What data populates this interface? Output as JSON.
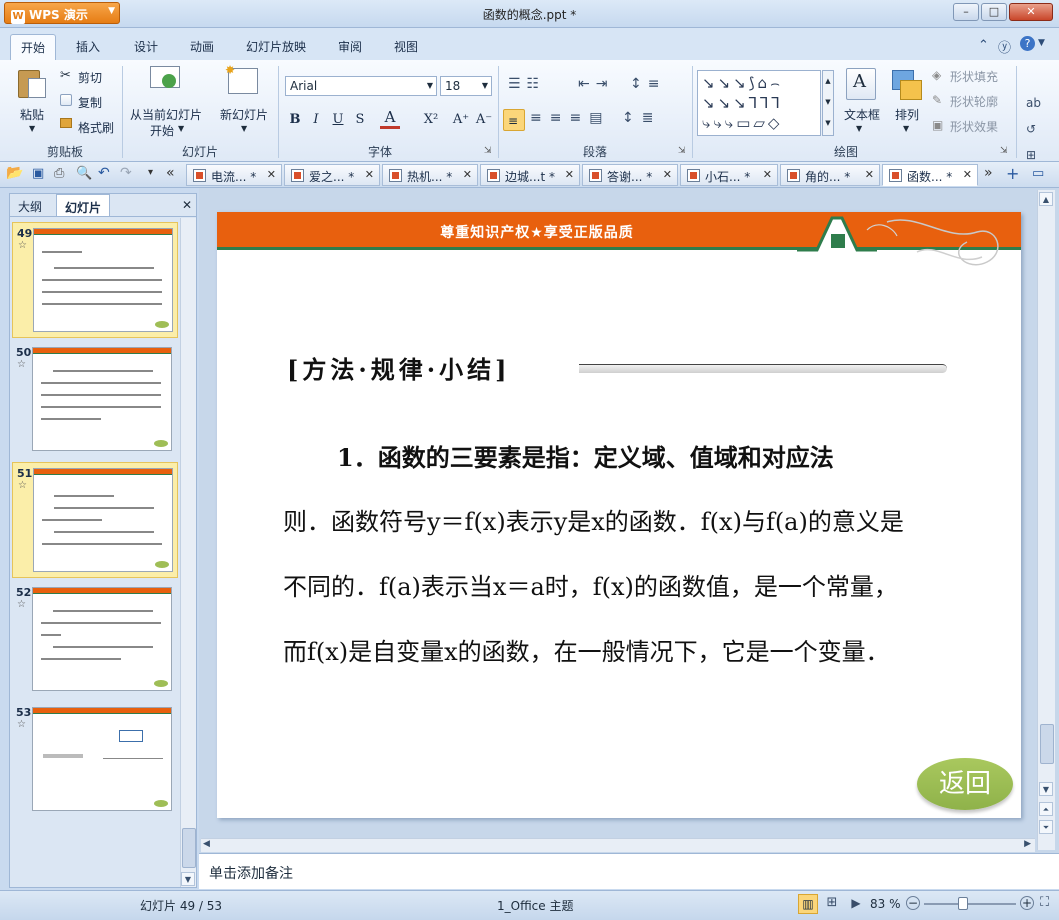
{
  "app": {
    "name": "WPS 演示",
    "title": "函数的概念.ppt *"
  },
  "window_controls": {
    "minimize": "–",
    "restore": "□",
    "close": "✕"
  },
  "ribbon_tabs": [
    "开始",
    "插入",
    "设计",
    "动画",
    "幻灯片放映",
    "审阅",
    "视图"
  ],
  "active_tab": "开始",
  "clipboard": {
    "paste": "粘贴",
    "cut": "剪切",
    "copy": "复制",
    "format_painter": "格式刷",
    "group": "剪贴板"
  },
  "slides_group": {
    "from_current": "从当前幻灯片",
    "start": "开始",
    "new_slide": "新幻灯片",
    "group": "幻灯片"
  },
  "font_group": {
    "font_name": "Arial",
    "font_size": "18",
    "bold": "B",
    "italic": "I",
    "underline": "U",
    "shadow": "S",
    "color_a": "A",
    "superscript": "X²",
    "grow": "A⁺",
    "shrink": "A⁻",
    "group": "字体"
  },
  "paragraph_group": {
    "group": "段落"
  },
  "drawing_group": {
    "text_box": "文本框",
    "arrange": "排列",
    "shape_fill": "形状填充",
    "shape_outline": "形状轮廓",
    "shape_effect": "形状效果",
    "group": "绘图"
  },
  "doc_tabs": [
    {
      "label": "电流... *"
    },
    {
      "label": "爱之... *"
    },
    {
      "label": "热机... *"
    },
    {
      "label": "边城...t *"
    },
    {
      "label": "答谢... *"
    },
    {
      "label": "小石... *"
    },
    {
      "label": "角的... *"
    },
    {
      "label": "函数... *"
    }
  ],
  "left_panel": {
    "tab_outline": "大纲",
    "tab_slides": "幻灯片",
    "thumbs": [
      {
        "num": "49",
        "star": "☆",
        "selected": true
      },
      {
        "num": "50",
        "star": "☆",
        "selected": false
      },
      {
        "num": "51",
        "star": "☆",
        "selected": true
      },
      {
        "num": "52",
        "star": "☆",
        "selected": false
      },
      {
        "num": "53",
        "star": "☆",
        "selected": false
      }
    ]
  },
  "slide": {
    "banner": "尊重知识产权★享受正版品质",
    "heading": "[方法·规律·小结]",
    "line1": "1．函数的三要素是指：定义域、值域和对应法",
    "line2": "则．函数符号y＝f(x)表示y是x的函数．f(x)与f(a)的意义是",
    "line3": "不同的．f(a)表示当x＝a时，f(x)的函数值，是一个常量，",
    "line4": "而f(x)是自变量x的函数，在一般情况下，它是一个变量．",
    "back_button": "返回"
  },
  "notes_placeholder": "单击添加备注",
  "status": {
    "slide_counter": "幻灯片 49 / 53",
    "theme": "1_Office 主题",
    "zoom": "83 %"
  },
  "colors": {
    "banner": "#e8600e",
    "accent_green": "#2f7d4c",
    "back_button": "#9fbe56"
  }
}
